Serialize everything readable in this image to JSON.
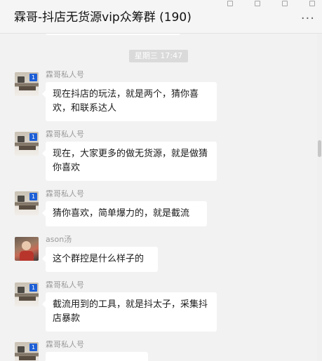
{
  "window": {
    "title": "霖哥-抖店无货源vip众筹群 (190)",
    "more_label": "···"
  },
  "chat": {
    "time_divider": "星期三 17:47",
    "messages": [
      {
        "sender": "霖哥私人号",
        "avatar": "desk-photo",
        "badge": "1",
        "text": "现在抖店的玩法，就是两个，猜你喜欢，和联系达人"
      },
      {
        "sender": "霖哥私人号",
        "avatar": "desk-photo",
        "badge": "1",
        "text": "现在，大家更多的做无货源，就是做猜你喜欢"
      },
      {
        "sender": "霖哥私人号",
        "avatar": "desk-photo",
        "badge": "1",
        "text": "猜你喜欢，简单爆力的，就是截流"
      },
      {
        "sender": "ason汤",
        "avatar": "person-photo",
        "text": "这个群控是什么样子的"
      },
      {
        "sender": "霖哥私人号",
        "avatar": "desk-photo",
        "badge": "1",
        "text": "截流用到的工具，就是抖太子，采集抖店暴款"
      },
      {
        "sender": "霖哥私人号",
        "avatar": "desk-photo",
        "badge": "1",
        "text": ""
      }
    ]
  },
  "colors": {
    "background": "#f2f2f2",
    "bubble": "#ffffff",
    "badge": "#1e5fd6",
    "sender_text": "#9a9a9a"
  }
}
